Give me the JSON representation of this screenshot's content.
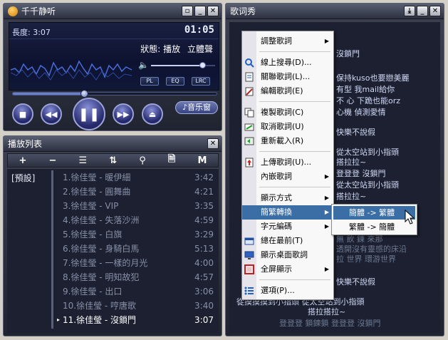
{
  "player": {
    "title": "千千静听",
    "length_label": "長度: 3:07",
    "time": "01:05",
    "status_label": "狀態: 播放",
    "stereo_label": "立體聲",
    "mini_buttons": [
      "PL",
      "EQ",
      "LRC"
    ],
    "music_window_label": "音乐窗",
    "volume": 0.8,
    "progress": 0.35
  },
  "playlist": {
    "title": "播放列表",
    "toolbar": [
      "+",
      "−",
      "☰",
      "⇅",
      "⚲",
      "🗎",
      "M"
    ],
    "group": "[預設]",
    "tracks": [
      {
        "title": "1.徐佳瑩 - 暖伊細",
        "duration": "3:42"
      },
      {
        "title": "2.徐佳瑩 - 圓舞曲",
        "duration": "4:21"
      },
      {
        "title": "3.徐佳瑩 - VIP",
        "duration": "3:35"
      },
      {
        "title": "4.徐佳瑩 - 失落沙洲",
        "duration": "4:59"
      },
      {
        "title": "5.徐佳瑩 - 白旗",
        "duration": "3:29"
      },
      {
        "title": "6.徐佳瑩 - 身騎白馬",
        "duration": "5:13"
      },
      {
        "title": "7.徐佳瑩 - 一樣的月光",
        "duration": "4:00"
      },
      {
        "title": "8.徐佳瑩 - 明知故犯",
        "duration": "4:57"
      },
      {
        "title": "9.徐佳瑩 - 出口",
        "duration": "3:06"
      },
      {
        "title": "10.徐佳瑩 - 哼唐歌",
        "duration": "3:40"
      },
      {
        "title": "11.徐佳瑩 - 沒鎖門",
        "duration": "3:07"
      }
    ],
    "current_index": 10
  },
  "lyric": {
    "title": "歌词秀",
    "lines": [
      {
        "text": "沒鎖門",
        "dim": false
      },
      {
        "text": "保持kuso也要戀美麗",
        "dim": false
      },
      {
        "text": "有型 我mail給你",
        "dim": false
      },
      {
        "text": "不 心 下跪也能orz",
        "dim": false
      },
      {
        "text": "心機 偵測愛情",
        "dim": false
      },
      {
        "text": "快樂不說假",
        "dim": false
      },
      {
        "text": "從太空站到小指頭",
        "dim": false
      },
      {
        "text": "搭拉拉~",
        "dim": false
      },
      {
        "text": "登登登 沒鎖門",
        "dim": false
      },
      {
        "text": "從太空站到小指頭",
        "dim": false
      },
      {
        "text": "搭拉拉~",
        "dim": false
      },
      {
        "text": "無 飲 鍊 來那",
        "dim": true
      },
      {
        "text": "透開沒有靈感的床沿",
        "dim": true
      },
      {
        "text": "拉 世界 環游世界",
        "dim": true
      },
      {
        "text": "快樂不說假",
        "dim": false
      },
      {
        "text": "從摸摸摸到小指頭 從太空站到小指頭",
        "dim": false
      },
      {
        "text": "搭拉搭拉~",
        "dim": false
      },
      {
        "text": "登登登 鎖鍊鎖 登登登 沒鎖門",
        "dim": true
      }
    ]
  },
  "context_menu": {
    "items": [
      {
        "label": "調整歌詞",
        "submenu": true
      },
      {
        "label": "線上搜尋(D)...",
        "submenu": false
      },
      {
        "label": "關聯歌詞(L)...",
        "submenu": false
      },
      {
        "label": "編輯歌詞(E)",
        "submenu": false
      },
      {
        "label": "複製歌詞(C)",
        "submenu": false
      },
      {
        "label": "取消歌詞(U)",
        "submenu": false
      },
      {
        "label": "重新載入(R)",
        "submenu": false
      },
      {
        "label": "上傳歌詞(U)...",
        "submenu": false
      },
      {
        "label": "內嵌歌詞",
        "submenu": true
      },
      {
        "label": "顯示方式",
        "submenu": true
      },
      {
        "label": "簡繁轉換",
        "submenu": true
      },
      {
        "label": "字元編碼",
        "submenu": true
      },
      {
        "label": "總在最前(T)",
        "submenu": false
      },
      {
        "label": "顯示桌面歌詞",
        "submenu": false
      },
      {
        "label": "全屏顯示",
        "submenu": true
      },
      {
        "label": "選項(P)...",
        "submenu": false
      }
    ],
    "active_index": 10
  },
  "submenu": {
    "items": [
      "簡體 -> 繁體",
      "繁體 -> 簡體"
    ],
    "active_index": 0
  },
  "colors": {
    "menu_highlight": "#3a6ea5",
    "background": "#202430"
  }
}
